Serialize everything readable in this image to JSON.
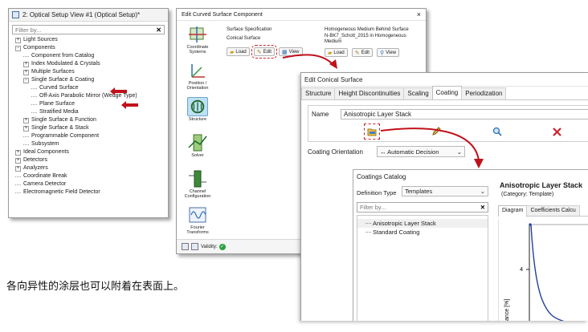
{
  "panel1": {
    "title": "2: Optical Setup View #1 (Optical Setup)*",
    "filter_placeholder": "Filter by...",
    "tree": [
      {
        "label": "Light Sources",
        "depth": 0,
        "toggle": "+"
      },
      {
        "label": "Components",
        "depth": 0,
        "toggle": "-"
      },
      {
        "label": "Component from Catalog",
        "depth": 1,
        "toggle": ""
      },
      {
        "label": "Index Modulated & Crystals",
        "depth": 1,
        "toggle": "+"
      },
      {
        "label": "Multiple Surfaces",
        "depth": 1,
        "toggle": "+"
      },
      {
        "label": "Single Surface & Coating",
        "depth": 1,
        "toggle": "-"
      },
      {
        "label": "Curved Surface",
        "depth": 2,
        "toggle": "",
        "marked": true
      },
      {
        "label": "Off-Axis Parabolic Mirror (Wedge Type)",
        "depth": 2,
        "toggle": ""
      },
      {
        "label": "Plane Surface",
        "depth": 2,
        "toggle": "",
        "marked": true
      },
      {
        "label": "Stratified Media",
        "depth": 2,
        "toggle": ""
      },
      {
        "label": "Single Surface & Function",
        "depth": 1,
        "toggle": "+"
      },
      {
        "label": "Single Surface & Stack",
        "depth": 1,
        "toggle": "+"
      },
      {
        "label": "Programmable Component",
        "depth": 1,
        "toggle": ""
      },
      {
        "label": "Subsystem",
        "depth": 1,
        "toggle": ""
      },
      {
        "label": "Ideal Components",
        "depth": 0,
        "toggle": "+"
      },
      {
        "label": "Detectors",
        "depth": 0,
        "toggle": "+"
      },
      {
        "label": "Analyzers",
        "depth": 0,
        "toggle": "+"
      },
      {
        "label": "Coordinate Break",
        "depth": 0,
        "toggle": ""
      },
      {
        "label": "Camera Detector",
        "depth": 0,
        "toggle": ""
      },
      {
        "label": "Electromagnetic Field Detector",
        "depth": 0,
        "toggle": ""
      }
    ]
  },
  "panel2": {
    "title": "Edit Curved Surface Component",
    "close": "×",
    "sidebar": [
      {
        "label": "Coordinate Systems",
        "icon": "coordinate-systems-icon"
      },
      {
        "label": "Position / Orientation",
        "icon": "position-orientation-icon"
      },
      {
        "label": "Structure",
        "icon": "structure-icon",
        "active": true
      },
      {
        "label": "Solver",
        "icon": "solver-icon"
      },
      {
        "label": "Channel Configuration",
        "icon": "channel-configuration-icon"
      },
      {
        "label": "Fourier Transforms",
        "icon": "fourier-transforms-icon"
      }
    ],
    "surface_spec_heading": "Surface Specification",
    "surface_spec_value": "Conical Surface",
    "medium_heading": "Homogeneous Medium Behind Surface",
    "medium_value": "N-BK7_Schott_2015 in Homogeneous Medium",
    "load_label": "Load",
    "edit_label": "Edit",
    "view_label": "View",
    "validity_label": "Validity:",
    "validity_mark": "✓"
  },
  "panel3": {
    "title": "Edit Conical Surface",
    "tabs": [
      "Structure",
      "Height Discontinuities",
      "Scaling",
      "Coating",
      "Periodization"
    ],
    "active_tab": "Coating",
    "name_label": "Name",
    "name_value": "Anisotropic Layer Stack",
    "orientation_label": "Coating Orientation",
    "orientation_value": "↔ Automatic Decision",
    "catalog": {
      "title": "Coatings Catalog",
      "definition_type_label": "Definition Type",
      "definition_type_value": "Templates",
      "filter_placeholder": "Filter by...",
      "items": [
        "Anisotropic Layer Stack",
        "Standard Coating"
      ],
      "detail_title": "Anisotropic Layer Stack",
      "detail_category": "(Category: Template)",
      "detail_tabs": [
        "Diagram",
        "Coefficients Calcu"
      ],
      "plot_ytick": "4",
      "plot_ylabel": "ance [%]"
    }
  },
  "caption": "各向异性的涂层也可以附着在表面上。",
  "colors": {
    "highlight_red": "#c0111b",
    "active_blue": "#bfe0f5",
    "curve_blue": "#1f3f9a"
  }
}
